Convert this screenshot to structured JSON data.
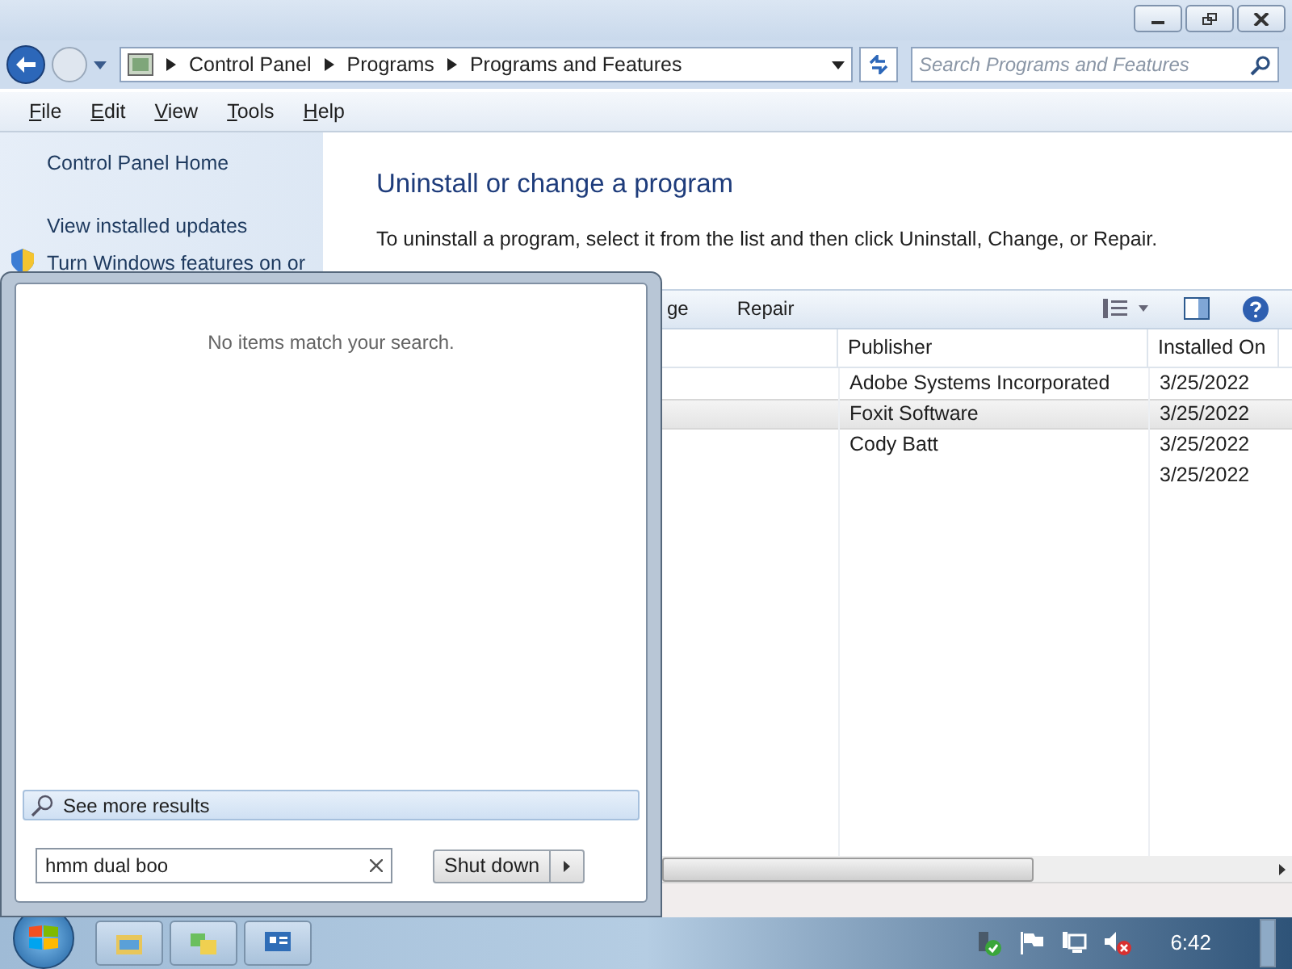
{
  "window": {
    "breadcrumb": [
      "Control Panel",
      "Programs",
      "Programs and Features"
    ],
    "search": {
      "placeholder": "Search Programs and Features"
    }
  },
  "menu": [
    "File",
    "Edit",
    "View",
    "Tools",
    "Help"
  ],
  "sidebar": {
    "links": [
      {
        "label": "Control Panel Home",
        "kind": "link"
      },
      {
        "label": "View installed updates",
        "kind": "link"
      },
      {
        "label": "Turn Windows features on or",
        "kind": "shield"
      }
    ]
  },
  "main": {
    "title": "Uninstall or change a program",
    "description": "To uninstall a program, select it from the list and then click Uninstall, Change, or Repair.",
    "toolbar": [
      "ge",
      "Repair"
    ],
    "columns": [
      "Publisher",
      "Installed On"
    ],
    "rows": [
      {
        "publisher": "Adobe Systems Incorporated",
        "installed": "3/25/2022",
        "selected": false
      },
      {
        "publisher": "Foxit Software",
        "installed": "3/25/2022",
        "selected": true
      },
      {
        "publisher": "Cody Batt",
        "installed": "3/25/2022",
        "selected": false
      },
      {
        "installed": "3/25/2022",
        "selected": false
      }
    ]
  },
  "start_menu": {
    "empty_message": "No items match your search.",
    "see_more": "See more results",
    "search": {
      "value": "hmm dual boo"
    },
    "shutdown": "Shut down"
  },
  "taskbar": {
    "clock": "6:42"
  }
}
